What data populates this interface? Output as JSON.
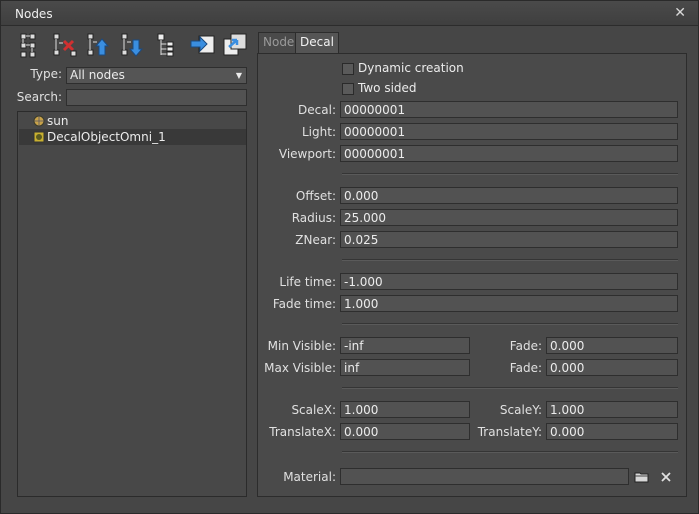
{
  "window": {
    "title": "Nodes",
    "close_glyph": "✕"
  },
  "toolbar": {
    "buttons": [
      {
        "name": "new-node-icon"
      },
      {
        "name": "delete-node-icon"
      },
      {
        "name": "move-up-icon"
      },
      {
        "name": "move-down-icon"
      },
      {
        "name": "node-list-icon"
      },
      {
        "name": "import-node-icon"
      },
      {
        "name": "export-node-icon"
      }
    ]
  },
  "filter": {
    "type_label": "Type:",
    "type_value": "All nodes",
    "search_label": "Search:",
    "search_value": ""
  },
  "tree": {
    "items": [
      {
        "label": "sun",
        "icon": "light-globe-icon",
        "selected": false
      },
      {
        "label": "DecalObjectOmni_1",
        "icon": "decal-object-icon",
        "selected": true
      }
    ]
  },
  "tabs": [
    {
      "label": "Node",
      "active": false
    },
    {
      "label": "Decal",
      "active": true
    }
  ],
  "decal": {
    "dynamic_creation": {
      "label": "Dynamic creation",
      "checked": false
    },
    "two_sided": {
      "label": "Two sided",
      "checked": false
    },
    "decal_label": "Decal:",
    "decal_value": "00000001",
    "light_label": "Light:",
    "light_value": "00000001",
    "viewport_label": "Viewport:",
    "viewport_value": "00000001",
    "offset_label": "Offset:",
    "offset_value": "0.000",
    "radius_label": "Radius:",
    "radius_value": "25.000",
    "znear_label": "ZNear:",
    "znear_value": "0.025",
    "lifetime_label": "Life time:",
    "lifetime_value": "-1.000",
    "fadetime_label": "Fade time:",
    "fadetime_value": "1.000",
    "minvisible_label": "Min Visible:",
    "minvisible_value": "-inf",
    "minfade_label": "Fade:",
    "minfade_value": "0.000",
    "maxvisible_label": "Max Visible:",
    "maxvisible_value": "inf",
    "maxfade_label": "Fade:",
    "maxfade_value": "0.000",
    "scalex_label": "ScaleX:",
    "scalex_value": "1.000",
    "scaley_label": "ScaleY:",
    "scaley_value": "1.000",
    "translatex_label": "TranslateX:",
    "translatex_value": "0.000",
    "translatey_label": "TranslateY:",
    "translatey_value": "0.000",
    "material_label": "Material:",
    "material_value": ""
  }
}
